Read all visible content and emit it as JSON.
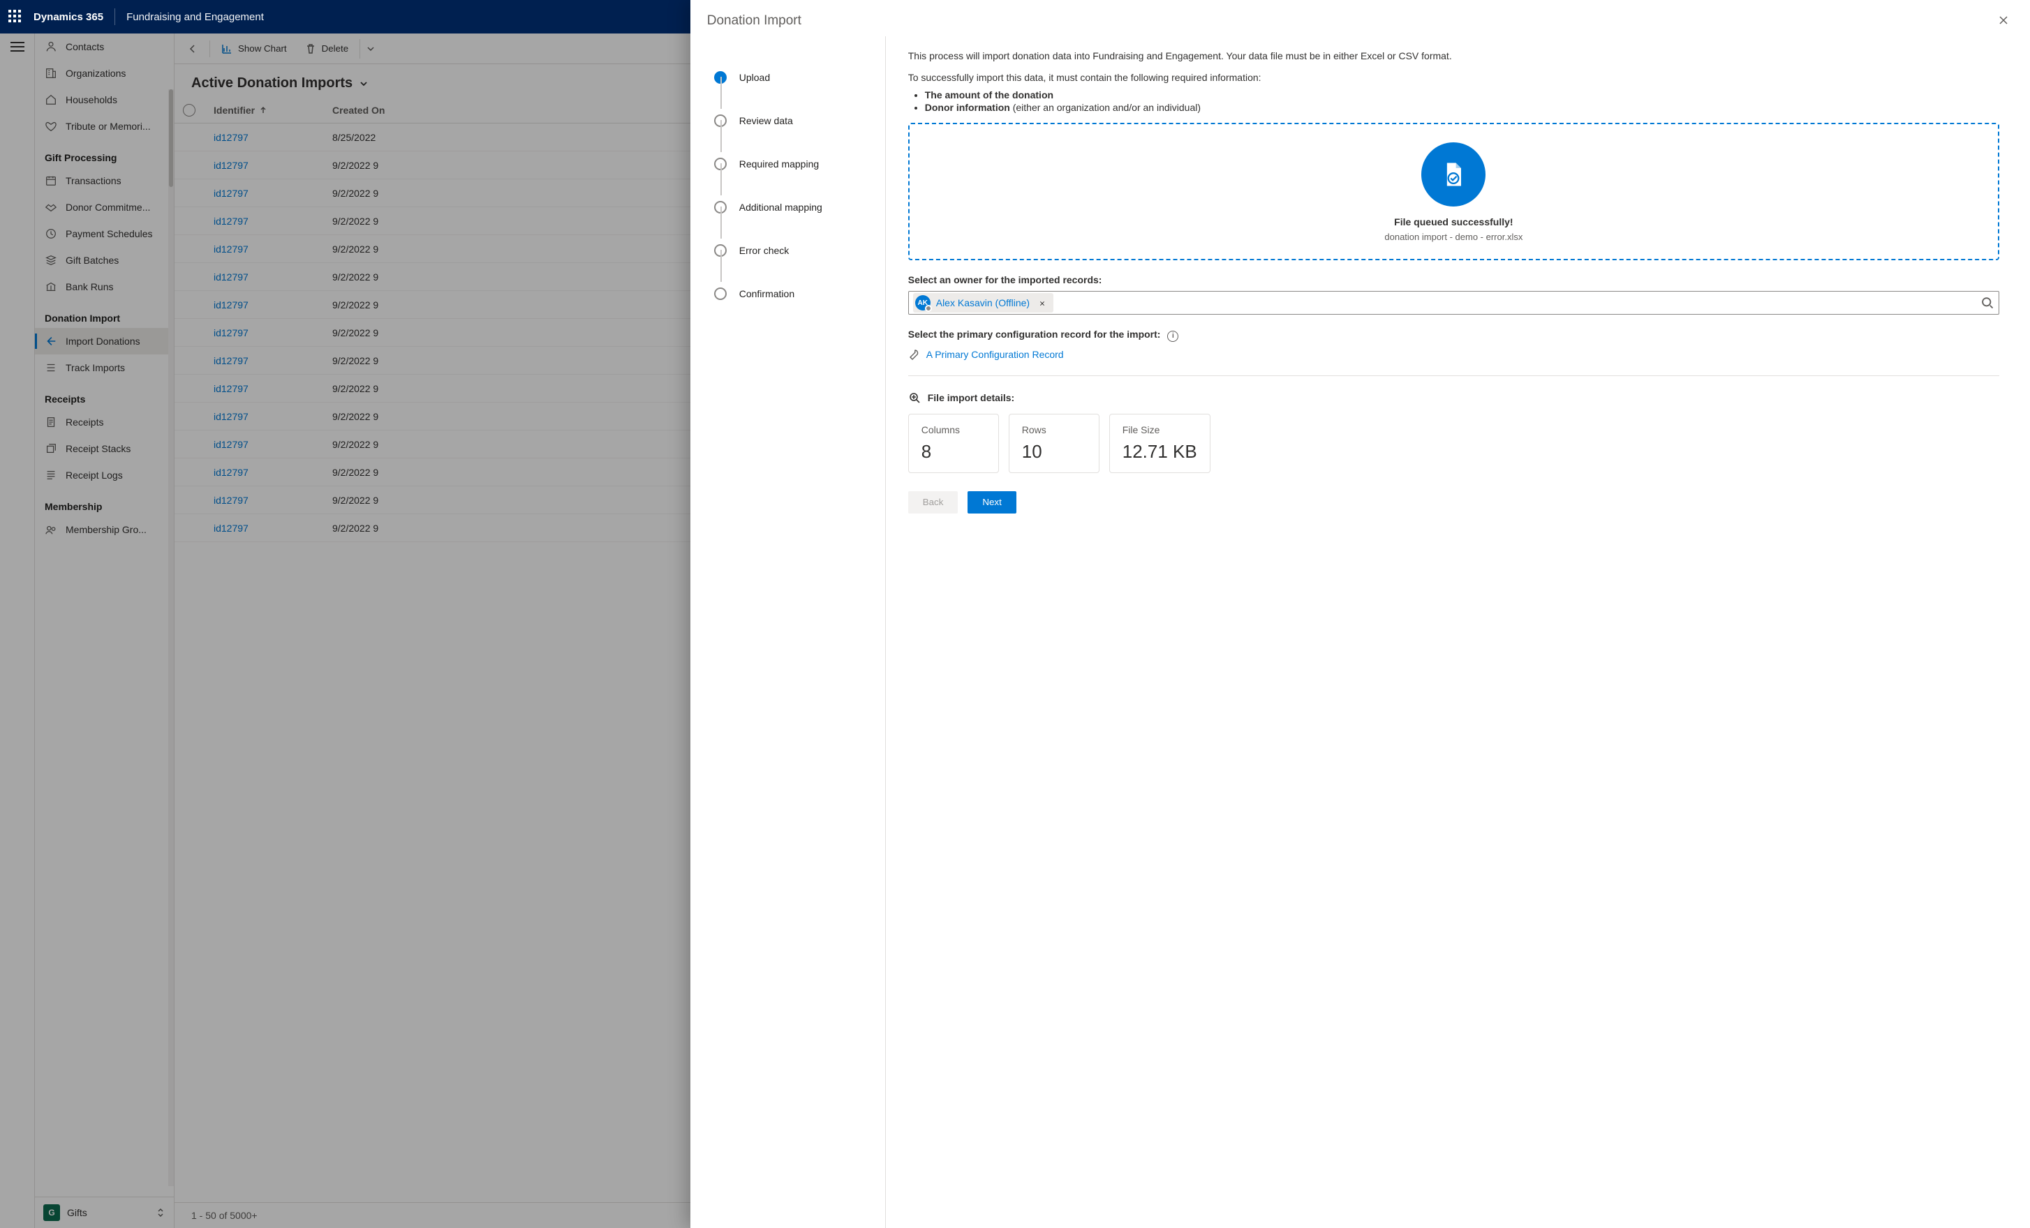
{
  "topbar": {
    "product": "Dynamics 365",
    "workload": "Fundraising and Engagement"
  },
  "sitemap": {
    "items1": [
      {
        "label": "Contacts"
      },
      {
        "label": "Organizations"
      },
      {
        "label": "Households"
      },
      {
        "label": "Tribute or Memori..."
      }
    ],
    "group_gift": "Gift Processing",
    "items_gift": [
      {
        "label": "Transactions"
      },
      {
        "label": "Donor Commitme..."
      },
      {
        "label": "Payment Schedules"
      },
      {
        "label": "Gift Batches"
      },
      {
        "label": "Bank Runs"
      }
    ],
    "group_import": "Donation Import",
    "items_import": [
      {
        "label": "Import Donations"
      },
      {
        "label": "Track Imports"
      }
    ],
    "group_receipts": "Receipts",
    "items_receipts": [
      {
        "label": "Receipts"
      },
      {
        "label": "Receipt Stacks"
      },
      {
        "label": "Receipt Logs"
      }
    ],
    "group_member": "Membership",
    "items_member": [
      {
        "label": "Membership Gro..."
      }
    ],
    "footer_badge": "G",
    "footer_label": "Gifts"
  },
  "cmdbar": {
    "show_chart": "Show Chart",
    "delete": "Delete"
  },
  "view": {
    "title": "Active Donation Imports"
  },
  "grid": {
    "cols": {
      "identifier": "Identifier",
      "created": "Created On"
    },
    "rows": [
      {
        "id": "id12797",
        "date": "8/25/2022"
      },
      {
        "id": "id12797",
        "date": "9/2/2022 9"
      },
      {
        "id": "id12797",
        "date": "9/2/2022 9"
      },
      {
        "id": "id12797",
        "date": "9/2/2022 9"
      },
      {
        "id": "id12797",
        "date": "9/2/2022 9"
      },
      {
        "id": "id12797",
        "date": "9/2/2022 9"
      },
      {
        "id": "id12797",
        "date": "9/2/2022 9"
      },
      {
        "id": "id12797",
        "date": "9/2/2022 9"
      },
      {
        "id": "id12797",
        "date": "9/2/2022 9"
      },
      {
        "id": "id12797",
        "date": "9/2/2022 9"
      },
      {
        "id": "id12797",
        "date": "9/2/2022 9"
      },
      {
        "id": "id12797",
        "date": "9/2/2022 9"
      },
      {
        "id": "id12797",
        "date": "9/2/2022 9"
      },
      {
        "id": "id12797",
        "date": "9/2/2022 9"
      },
      {
        "id": "id12797",
        "date": "9/2/2022 9"
      }
    ],
    "footer": "1 - 50 of 5000+"
  },
  "panel": {
    "title": "Donation Import",
    "steps": [
      "Upload",
      "Review data",
      "Required mapping",
      "Additional mapping",
      "Error check",
      "Confirmation"
    ],
    "intro1": "This process will import donation data into Fundraising and Engagement. Your data file must be in either Excel or CSV format.",
    "intro2": "To successfully import this data, it must contain the following required information:",
    "bullet1_bold": "The amount of the donation",
    "bullet2_bold": "Donor information",
    "bullet2_rest": " (either an organization and/or an individual)",
    "queued_title": "File queued successfully!",
    "queued_file": "donation import - demo - error.xlsx",
    "owner_label": "Select an owner for the imported records:",
    "owner_chip_initials": "AK",
    "owner_chip_name": "Alex Kasavin (Offline)",
    "config_label": "Select the primary configuration record for the import:",
    "config_link": "A Primary Configuration Record",
    "details_header": "File import details:",
    "cards": {
      "cols_label": "Columns",
      "cols_val": "8",
      "rows_label": "Rows",
      "rows_val": "10",
      "size_label": "File Size",
      "size_val": "12.71 KB"
    },
    "back": "Back",
    "next": "Next"
  }
}
